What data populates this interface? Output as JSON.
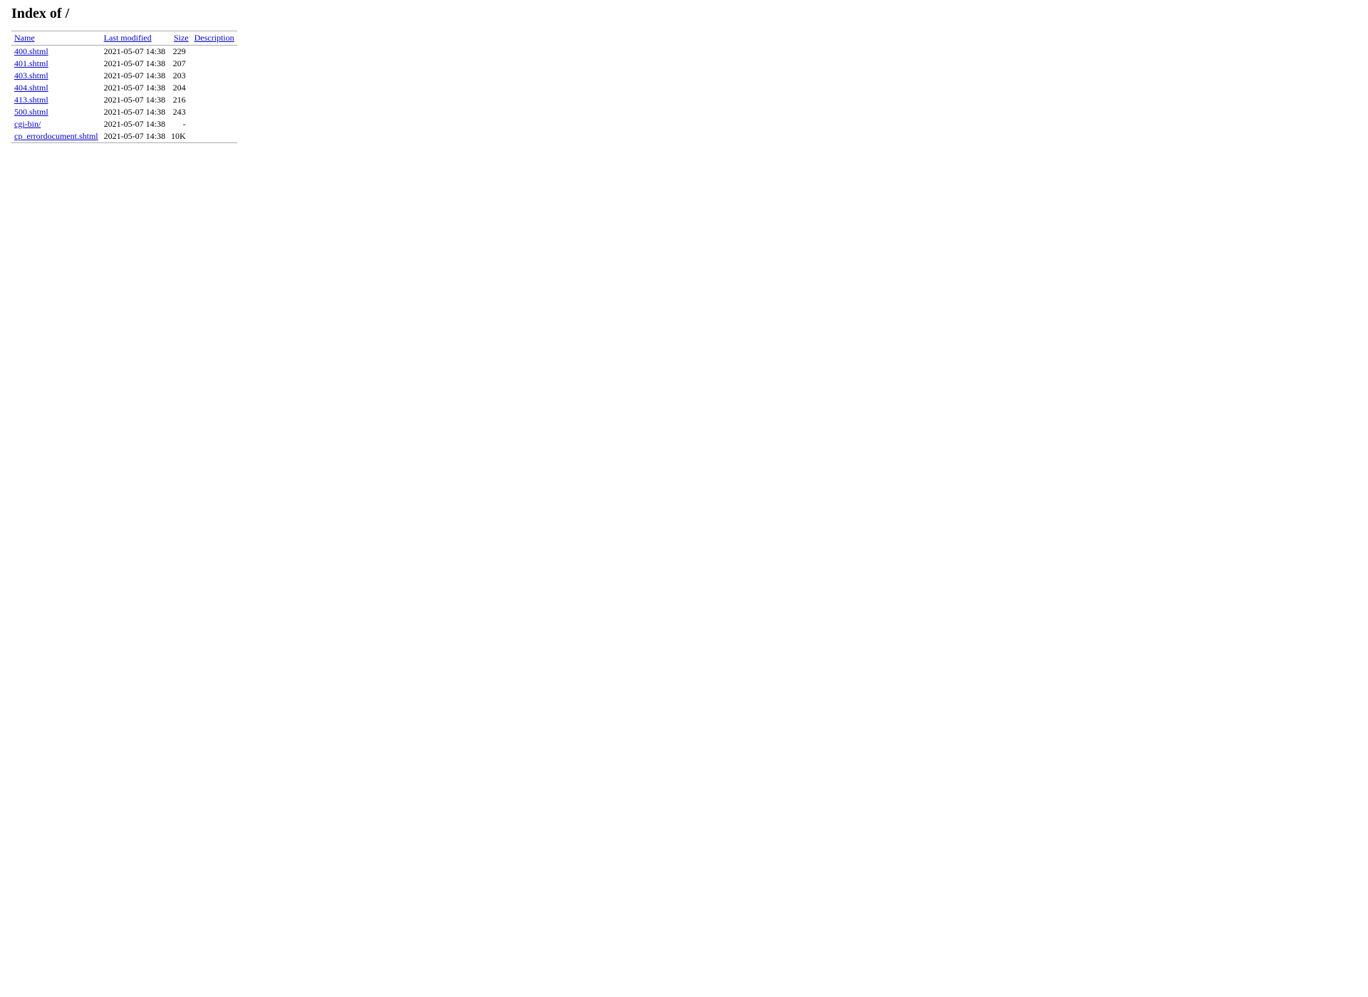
{
  "page": {
    "title": "Index of /",
    "columns": {
      "name": "Name",
      "last_modified": "Last modified",
      "size": "Size",
      "description": "Description"
    },
    "files": [
      {
        "name": "400.shtml",
        "modified": "2021-05-07 14:38",
        "size": "229",
        "description": ""
      },
      {
        "name": "401.shtml",
        "modified": "2021-05-07 14:38",
        "size": "207",
        "description": ""
      },
      {
        "name": "403.shtml",
        "modified": "2021-05-07 14:38",
        "size": "203",
        "description": ""
      },
      {
        "name": "404.shtml",
        "modified": "2021-05-07 14:38",
        "size": "204",
        "description": ""
      },
      {
        "name": "413.shtml",
        "modified": "2021-05-07 14:38",
        "size": "216",
        "description": ""
      },
      {
        "name": "500.shtml",
        "modified": "2021-05-07 14:38",
        "size": "243",
        "description": ""
      },
      {
        "name": "cgi-bin/",
        "modified": "2021-05-07 14:38",
        "size": "-",
        "description": ""
      },
      {
        "name": "cp_errordocument.shtml",
        "modified": "2021-05-07 14:38",
        "size": "10K",
        "description": ""
      }
    ]
  }
}
